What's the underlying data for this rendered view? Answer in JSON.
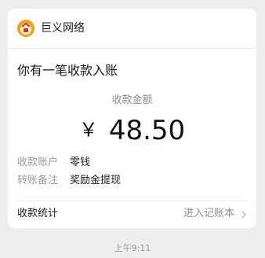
{
  "merchant": {
    "name": "巨义网络",
    "logo_icon": "merchant-logo-icon",
    "logo_color": "#f3a21b"
  },
  "message": {
    "title": "你有一笔收款入账"
  },
  "payment": {
    "amount_label": "收款金额",
    "currency_symbol": "￥",
    "amount": "48.50"
  },
  "details": [
    {
      "key": "收款账户",
      "value": "零钱"
    },
    {
      "key": "转账备注",
      "value": "奖励金提现"
    }
  ],
  "footer": {
    "stats_label": "收款统计",
    "ledger_link": "进入记账本",
    "ledger_icon": "chevron-right-icon"
  },
  "timestamp": "上午9:11",
  "colors": {
    "background": "#ededed",
    "card": "#ffffff",
    "primary_text": "#1a1a1a",
    "secondary_text": "#8c8c8c"
  }
}
